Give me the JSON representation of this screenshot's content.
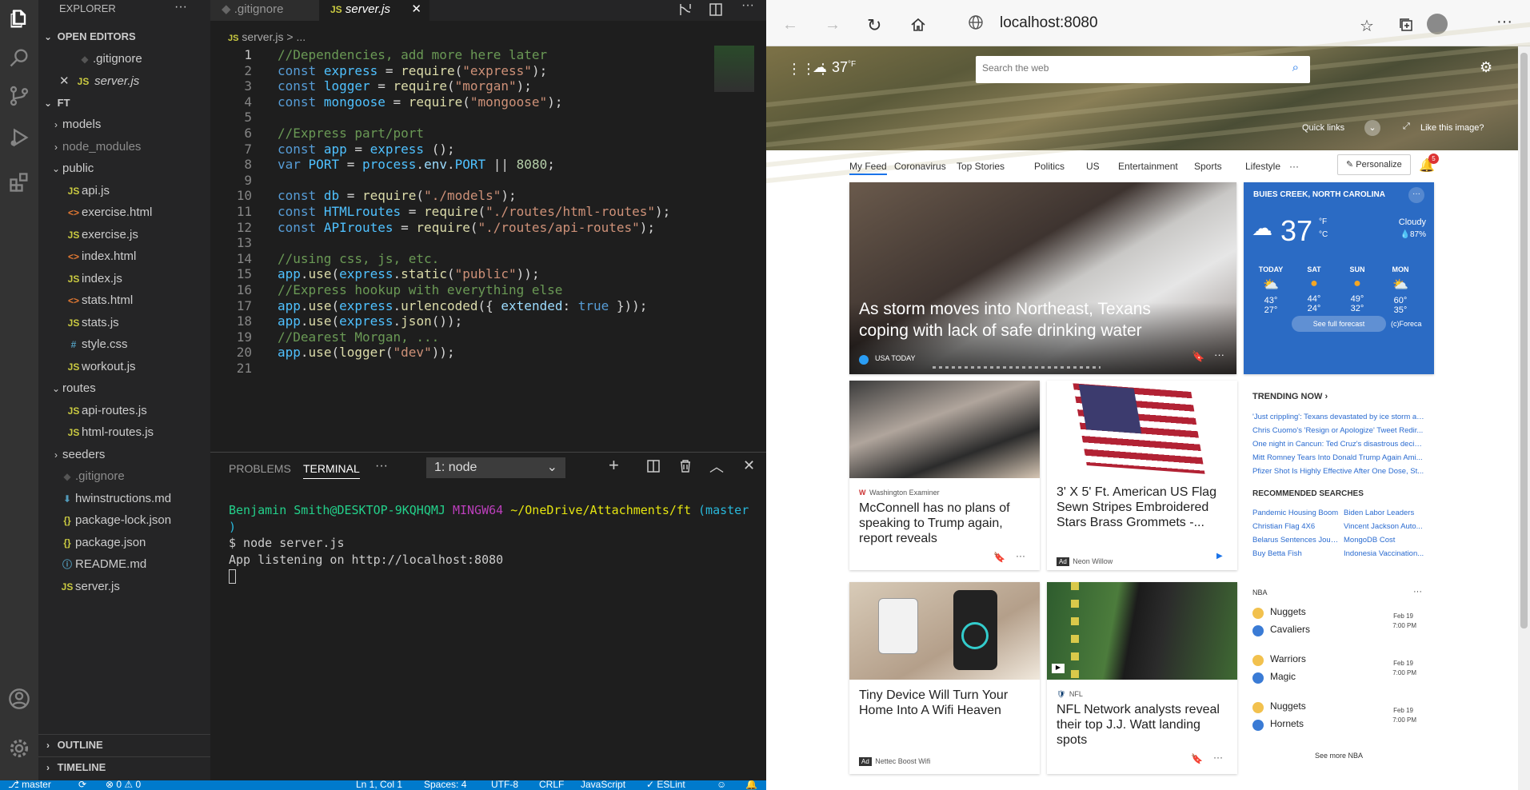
{
  "vscode": {
    "explorer_title": "EXPLORER",
    "tabs": [
      {
        "label": ".gitignore"
      },
      {
        "label": "server.js"
      }
    ],
    "open_editors_title": "OPEN EDITORS",
    "open_editors": [
      {
        "label": ".gitignore"
      },
      {
        "label": "server.js"
      }
    ],
    "folder_name": "FT",
    "tree": [
      {
        "label": "models",
        "type": "folder"
      },
      {
        "label": "node_modules",
        "type": "folder"
      },
      {
        "label": "public",
        "type": "folder-open"
      },
      {
        "label": "api.js",
        "type": "js"
      },
      {
        "label": "exercise.html",
        "type": "html"
      },
      {
        "label": "exercise.js",
        "type": "js"
      },
      {
        "label": "index.html",
        "type": "html"
      },
      {
        "label": "index.js",
        "type": "js"
      },
      {
        "label": "stats.html",
        "type": "html"
      },
      {
        "label": "stats.js",
        "type": "js"
      },
      {
        "label": "style.css",
        "type": "css"
      },
      {
        "label": "workout.js",
        "type": "js"
      },
      {
        "label": "routes",
        "type": "folder-open"
      },
      {
        "label": "api-routes.js",
        "type": "js"
      },
      {
        "label": "html-routes.js",
        "type": "js"
      },
      {
        "label": "seeders",
        "type": "folder"
      },
      {
        "label": ".gitignore",
        "type": "git"
      },
      {
        "label": "hwinstructions.md",
        "type": "md"
      },
      {
        "label": "package-lock.json",
        "type": "json"
      },
      {
        "label": "package.json",
        "type": "json"
      },
      {
        "label": "README.md",
        "type": "info"
      },
      {
        "label": "server.js",
        "type": "js"
      }
    ],
    "outline_label": "OUTLINE",
    "timeline_label": "TIMELINE",
    "breadcrumb": "server.js > ...",
    "code_lines": [
      "//Dependencies, add more here later",
      "const express = require(\"express\");",
      "const logger = require(\"morgan\");",
      "const mongoose = require(\"mongoose\");",
      "",
      "//Express part/port",
      "const app = express ();",
      "var PORT = process.env.PORT || 8080;",
      "",
      "const db = require(\"./models\");",
      "const HTMLroutes = require(\"./routes/html-routes\");",
      "const APIroutes = require(\"./routes/api-routes\");",
      "",
      "//using css, js, etc.",
      "app.use(express.static(\"public\"));",
      "//Express hookup with everything else",
      "app.use(express.urlencoded({ extended: true }));",
      "app.use(express.json());",
      "//Dearest Morgan, ...",
      "app.use(logger(\"dev\"));",
      ""
    ],
    "panel": {
      "problems": "PROBLEMS",
      "terminal": "TERMINAL",
      "terminal_select": "1: node",
      "prompt_user": "Benjamin Smith@DESKTOP-9KQHQMJ",
      "prompt_shell": "MINGW64",
      "prompt_path": "~/OneDrive/Attachments/ft",
      "prompt_branch": "(master",
      "prompt_close": ")",
      "cmd": "$ node server.js",
      "output": "App listening on http://localhost:8080"
    },
    "status": {
      "branch": "master",
      "errors": "0",
      "warnings": "0",
      "position": "Ln 1, Col 1",
      "spaces": "Spaces: 4",
      "encoding": "UTF-8",
      "eol": "CRLF",
      "language": "JavaScript",
      "eslint": "ESLint"
    }
  },
  "edge": {
    "url": "localhost:8080",
    "temp_top": "37",
    "temp_unit_top": "°F",
    "search_placeholder": "Search the web",
    "quick_links": "Quick links",
    "like_image": "Like this image?",
    "nav": [
      "My Feed",
      "Coronavirus",
      "Top Stories",
      "Politics",
      "US",
      "Entertainment",
      "Sports",
      "Lifestyle",
      "···"
    ],
    "personalize": "Personalize",
    "notif_count": "5",
    "hero_card": {
      "title": "As storm moves into Northeast, Texans coping with lack of safe drinking water",
      "source": "USA TODAY"
    },
    "weather": {
      "location": "BUIES CREEK, NORTH CAROLINA",
      "temp": "37",
      "unit_f": "°F",
      "unit_c": "°C",
      "condition": "Cloudy",
      "precip": "87%",
      "days": [
        {
          "day": "TODAY",
          "hi": "43°",
          "lo": "27°",
          "icon": "partly-cloudy-icon"
        },
        {
          "day": "SAT",
          "hi": "44°",
          "lo": "24°",
          "icon": "sun-icon"
        },
        {
          "day": "SUN",
          "hi": "49°",
          "lo": "32°",
          "icon": "sun-icon"
        },
        {
          "day": "MON",
          "hi": "60°",
          "lo": "35°",
          "icon": "partly-cloudy-icon"
        }
      ],
      "full_forecast": "See full forecast",
      "credit": "(c)Foreca"
    },
    "cards": [
      {
        "source": "Washington Examiner",
        "title": "McConnell has no plans of speaking to Trump again, report reveals"
      },
      {
        "source": "Neon Willow",
        "ad": "Ad",
        "title": "3' X 5' Ft. American US Flag Sewn Stripes Embroidered Stars Brass Grommets -..."
      },
      {
        "source": "Nettec Boost Wifi",
        "ad": "Ad",
        "title": "Tiny Device Will Turn Your Home Into A Wifi Heaven"
      },
      {
        "source": "NFL",
        "title": "NFL Network analysts reveal their top J.J. Watt landing spots"
      }
    ],
    "trending_title": "TRENDING NOW",
    "trending": [
      "'Just crippling': Texans devastated by ice storm ar...",
      "Chris Cuomo's 'Resign or Apologize' Tweet Redir...",
      "One night in Cancun: Ted Cruz's disastrous decisi...",
      "Mitt Romney Tears Into Donald Trump Again Ami...",
      "Pfizer Shot Is Highly Effective After One Dose, St..."
    ],
    "recommended_title": "RECOMMENDED SEARCHES",
    "recommended": [
      "Pandemic Housing Boom",
      "Biden Labor Leaders",
      "Christian Flag 4X6",
      "Vincent Jackson Auto...",
      "Belarus Sentences Jour...",
      "MongoDB Cost",
      "Buy Betta Fish",
      "Indonesia Vaccination..."
    ],
    "nba_title": "NBA",
    "nba_games": [
      {
        "team1": "Nuggets",
        "team2": "Cavaliers",
        "date": "Feb 19",
        "time": "7:00 PM"
      },
      {
        "team1": "Warriors",
        "team2": "Magic",
        "date": "Feb 19",
        "time": "7:00 PM"
      },
      {
        "team1": "Nuggets",
        "team2": "Hornets",
        "date": "Feb 19",
        "time": "7:00 PM"
      }
    ],
    "see_more_nba": "See more NBA"
  }
}
